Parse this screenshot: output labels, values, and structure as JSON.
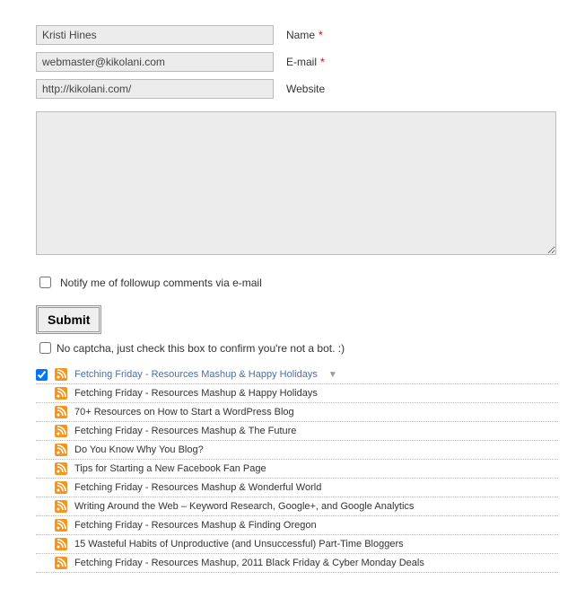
{
  "form": {
    "name": {
      "value": "Kristi Hines",
      "label": "Name",
      "required": true
    },
    "email": {
      "value": "webmaster@kikolani.com",
      "label": "E-mail",
      "required": true
    },
    "website": {
      "value": "http://kikolani.com/",
      "label": "Website",
      "required": false
    },
    "comment": {
      "value": ""
    },
    "notify_label": "Notify me of followup comments via e-mail",
    "submit_label": "Submit",
    "captcha_label": "No captcha, just check this box to confirm you're not a bot. :)"
  },
  "posts": [
    {
      "title": "Fetching Friday - Resources Mashup & Happy Holidays",
      "selected": true,
      "has_dropdown": true
    },
    {
      "title": "Fetching Friday - Resources Mashup & Happy Holidays",
      "selected": false
    },
    {
      "title": "70+ Resources on How to Start a WordPress Blog",
      "selected": false
    },
    {
      "title": "Fetching Friday - Resources Mashup & The Future",
      "selected": false
    },
    {
      "title": "Do You Know Why You Blog?",
      "selected": false
    },
    {
      "title": "Tips for Starting a New Facebook Fan Page",
      "selected": false
    },
    {
      "title": "Fetching Friday - Resources Mashup & Wonderful World",
      "selected": false
    },
    {
      "title": "Writing Around the Web – Keyword Research, Google+, and Google Analytics",
      "selected": false
    },
    {
      "title": "Fetching Friday - Resources Mashup & Finding Oregon",
      "selected": false
    },
    {
      "title": "15 Wasteful Habits of Unproductive (and Unsuccessful) Part-Time Bloggers",
      "selected": false
    },
    {
      "title": "Fetching Friday - Resources Mashup, 2011 Black Friday & Cyber Monday Deals",
      "selected": false
    }
  ],
  "required_mark": "*",
  "dropdown_glyph": "▼"
}
